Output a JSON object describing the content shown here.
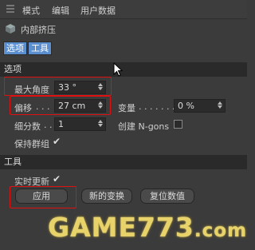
{
  "menubar": {
    "items": [
      "模式",
      "编辑",
      "用户数据"
    ]
  },
  "object": {
    "name": "内部挤压",
    "icon": "cube-icon"
  },
  "tabs": [
    {
      "label": "选项",
      "active": true
    },
    {
      "label": "工具",
      "active": true
    }
  ],
  "sections": {
    "options": "选项",
    "tools": "工具"
  },
  "params": {
    "max_angle": {
      "label": "最大角度",
      "value": "33 °"
    },
    "offset": {
      "label": "偏移",
      "dots": ". . .",
      "value": "27 cm"
    },
    "variance": {
      "label": "变量",
      "dots": ". . . . . . .",
      "value": "0 %"
    },
    "subdivision": {
      "label": "细分数",
      "dots": ". .",
      "value": "1"
    },
    "create_ngons": {
      "label": "创建 N-gons",
      "checked": false
    },
    "preserve_groups": {
      "label": "保持群组",
      "checked": true
    }
  },
  "tools": {
    "realtime_update": {
      "label": "实时更新",
      "checked": true
    },
    "apply_label": "应用",
    "new_transform_label": "新的变换",
    "reset_values_label": "复位数值"
  },
  "watermark": {
    "main": "GAME773",
    "suffix": ".com"
  },
  "colors": {
    "active_tab": "#5b8fd0",
    "highlight": "#dd1111",
    "watermark": "#e8d36a"
  }
}
